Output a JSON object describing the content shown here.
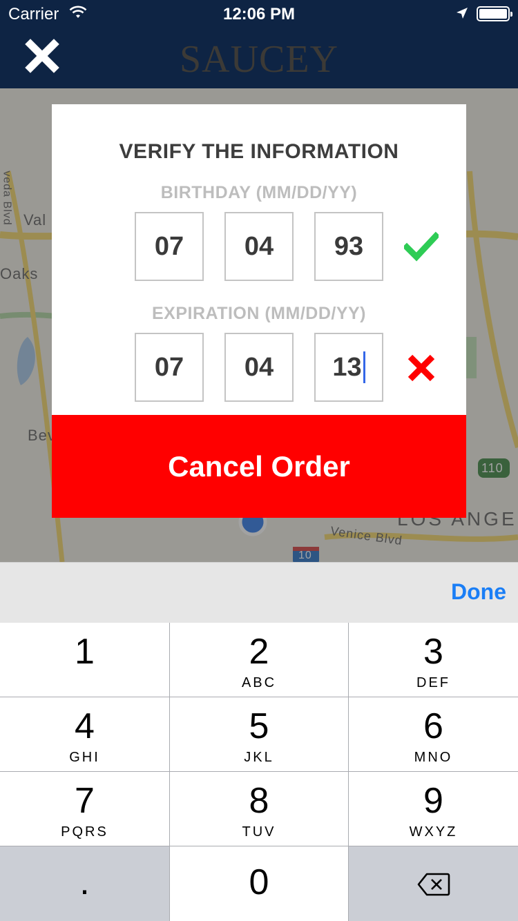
{
  "status_bar": {
    "carrier": "Carrier",
    "time": "12:06 PM"
  },
  "nav": {
    "brand": "SAUCEY"
  },
  "map": {
    "labels": [
      "Val",
      "Oaks",
      "Bev",
      "LOS ANGE",
      "Venice Blvd",
      "110",
      "10",
      "veda Blvd"
    ]
  },
  "modal": {
    "title": "VERIFY THE INFORMATION",
    "birthday": {
      "label": "BIRTHDAY (MM/DD/YY)",
      "mm": "07",
      "dd": "04",
      "yy": "93",
      "status": "valid"
    },
    "expiration": {
      "label": "EXPIRATION (MM/DD/YY)",
      "mm": "07",
      "dd": "04",
      "yy": "13",
      "status": "invalid"
    },
    "cancel_label": "Cancel Order"
  },
  "keyboard": {
    "done_label": "Done",
    "keys": [
      {
        "num": "1",
        "letters": ""
      },
      {
        "num": "2",
        "letters": "ABC"
      },
      {
        "num": "3",
        "letters": "DEF"
      },
      {
        "num": "4",
        "letters": "GHI"
      },
      {
        "num": "5",
        "letters": "JKL"
      },
      {
        "num": "6",
        "letters": "MNO"
      },
      {
        "num": "7",
        "letters": "PQRS"
      },
      {
        "num": "8",
        "letters": "TUV"
      },
      {
        "num": "9",
        "letters": "WXYZ"
      },
      {
        "num": ".",
        "letters": ""
      },
      {
        "num": "0",
        "letters": ""
      }
    ],
    "delete_icon": "backspace-icon"
  },
  "colors": {
    "nav": "#0e2444",
    "cancel": "#ff0000",
    "valid": "#2ecc55",
    "invalid": "#ff0000",
    "done": "#1a7ef6"
  }
}
